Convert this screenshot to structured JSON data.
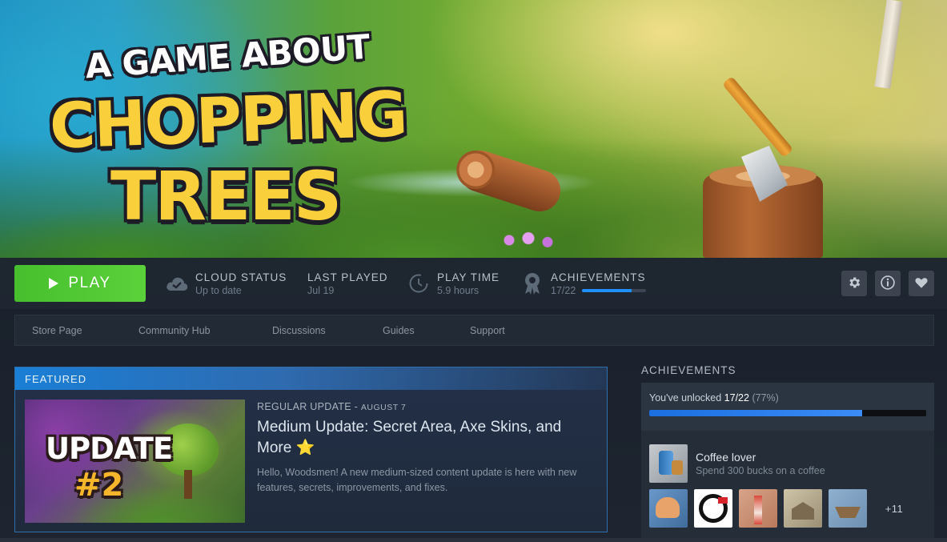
{
  "hero": {
    "logo_line1": "A GAME ABOUT",
    "logo_line2": "CHOPPING",
    "logo_line3": "TREES"
  },
  "actions": {
    "play_label": "PLAY",
    "cloud_label": "CLOUD STATUS",
    "cloud_value": "Up to date",
    "last_played_label": "LAST PLAYED",
    "last_played_value": "Jul 19",
    "play_time_label": "PLAY TIME",
    "play_time_value": "5.9 hours",
    "achievements_label": "ACHIEVEMENTS",
    "achievements_value": "17/22",
    "achievements_progress": 0.77,
    "icons": [
      "gear-icon",
      "info-icon",
      "heart-icon"
    ]
  },
  "nav": {
    "items": [
      "Store Page",
      "Community Hub",
      "Discussions",
      "Guides",
      "Support"
    ]
  },
  "featured": {
    "header": "FEATURED",
    "thumb_line1": "UPDATE",
    "thumb_line2": "#2",
    "kind": "REGULAR UPDATE",
    "separator": " - ",
    "date": "AUGUST 7",
    "title": "Medium Update: Secret Area, Axe Skins, and More ⭐",
    "description": "Hello, Woodsmen! A new medium-sized content update is here with new features, secrets, improvements, and fixes."
  },
  "achievements_panel": {
    "title": "ACHIEVEMENTS",
    "unlocked_prefix": "You've unlocked ",
    "unlocked_count": "17/22",
    "unlocked_pct": "(77%)",
    "progress": 0.77,
    "recent": {
      "name": "Coffee lover",
      "description": "Spend 300 bucks on a coffee"
    },
    "more_label": "+11"
  },
  "colors": {
    "play_green": "#5bd13a",
    "accent_blue": "#1f8fff",
    "background": "#1b2029"
  }
}
